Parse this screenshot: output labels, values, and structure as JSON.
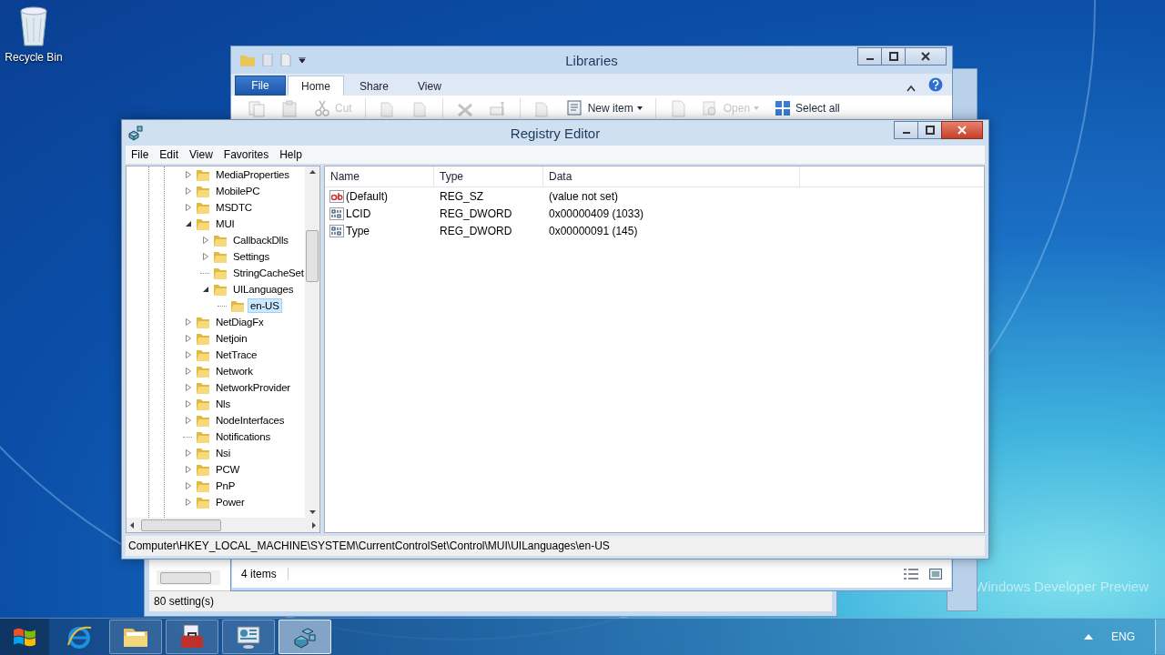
{
  "desktop": {
    "icons": [
      {
        "label": "Recycle Bin"
      }
    ],
    "watermark": "Windows Developer Preview"
  },
  "back_window": {
    "status": "80 setting(s)"
  },
  "libraries": {
    "title": "Libraries",
    "file_tab": "File",
    "tabs": [
      {
        "label": "Home",
        "selected": true
      },
      {
        "label": "Share",
        "selected": false
      },
      {
        "label": "View",
        "selected": false
      }
    ],
    "ribbon": [
      {
        "kind": "copy",
        "disabled": true
      },
      {
        "kind": "paste",
        "disabled": true
      },
      {
        "kind": "cut",
        "label": "Cut",
        "disabled": true
      },
      {
        "kind": "move",
        "disabled": true
      },
      {
        "kind": "copyto",
        "disabled": true
      },
      {
        "kind": "delete",
        "disabled": true
      },
      {
        "kind": "rename",
        "disabled": true
      },
      {
        "kind": "newfolder",
        "disabled": true
      },
      {
        "kind": "newitem",
        "label": "New item",
        "disabled": false,
        "dropdown": true
      },
      {
        "kind": "properties",
        "disabled": true
      },
      {
        "kind": "open",
        "label": "Open",
        "disabled": true,
        "dropdown": true
      },
      {
        "kind": "selectall",
        "label": "Select all",
        "disabled": false
      }
    ],
    "status": "4 items"
  },
  "registry": {
    "title": "Registry Editor",
    "menu": [
      "File",
      "Edit",
      "View",
      "Favorites",
      "Help"
    ],
    "tree": [
      {
        "label": "MediaProperties",
        "kind": "branch",
        "expanded": false,
        "selected": false
      },
      {
        "label": "MobilePC",
        "kind": "branch",
        "expanded": false,
        "selected": false
      },
      {
        "label": "MSDTC",
        "kind": "branch",
        "expanded": false,
        "selected": false
      },
      {
        "label": "MUI",
        "kind": "branch",
        "expanded": true,
        "selected": false,
        "children": [
          {
            "label": "CallbackDlls",
            "kind": "branch",
            "expanded": false,
            "selected": false
          },
          {
            "label": "Settings",
            "kind": "branch",
            "expanded": false,
            "selected": false
          },
          {
            "label": "StringCacheSet",
            "kind": "leaf",
            "selected": false
          },
          {
            "label": "UILanguages",
            "kind": "branch",
            "expanded": true,
            "selected": false,
            "children": [
              {
                "label": "en-US",
                "kind": "leaf",
                "selected": true
              }
            ]
          }
        ]
      },
      {
        "label": "NetDiagFx",
        "kind": "branch",
        "expanded": false,
        "selected": false
      },
      {
        "label": "Netjoin",
        "kind": "branch",
        "expanded": false,
        "selected": false
      },
      {
        "label": "NetTrace",
        "kind": "branch",
        "expanded": false,
        "selected": false
      },
      {
        "label": "Network",
        "kind": "branch",
        "expanded": false,
        "selected": false
      },
      {
        "label": "NetworkProvider",
        "kind": "branch",
        "expanded": false,
        "selected": false
      },
      {
        "label": "Nls",
        "kind": "branch",
        "expanded": false,
        "selected": false
      },
      {
        "label": "NodeInterfaces",
        "kind": "branch",
        "expanded": false,
        "selected": false
      },
      {
        "label": "Notifications",
        "kind": "leaf",
        "selected": false
      },
      {
        "label": "Nsi",
        "kind": "branch",
        "expanded": false,
        "selected": false
      },
      {
        "label": "PCW",
        "kind": "branch",
        "expanded": false,
        "selected": false
      },
      {
        "label": "PnP",
        "kind": "branch",
        "expanded": false,
        "selected": false
      },
      {
        "label": "Power",
        "kind": "branch",
        "expanded": false,
        "selected": false
      }
    ],
    "columns": [
      "Name",
      "Type",
      "Data"
    ],
    "rows": [
      {
        "kind": "string",
        "name": "(Default)",
        "type": "REG_SZ",
        "data": "(value not set)"
      },
      {
        "kind": "binary",
        "name": "LCID",
        "type": "REG_DWORD",
        "data": "0x00000409 (1033)"
      },
      {
        "kind": "binary",
        "name": "Type",
        "type": "REG_DWORD",
        "data": "0x00000091 (145)"
      }
    ],
    "status": "Computer\\HKEY_LOCAL_MACHINE\\SYSTEM\\CurrentControlSet\\Control\\MUI\\UILanguages\\en-US"
  },
  "taskbar": {
    "apps": [
      {
        "kind": "ie",
        "active": false
      },
      {
        "kind": "explorer",
        "active": false
      },
      {
        "kind": "toolbox",
        "active": false
      },
      {
        "kind": "control",
        "active": false
      },
      {
        "kind": "regedit",
        "active": true
      }
    ],
    "language": "ENG"
  }
}
